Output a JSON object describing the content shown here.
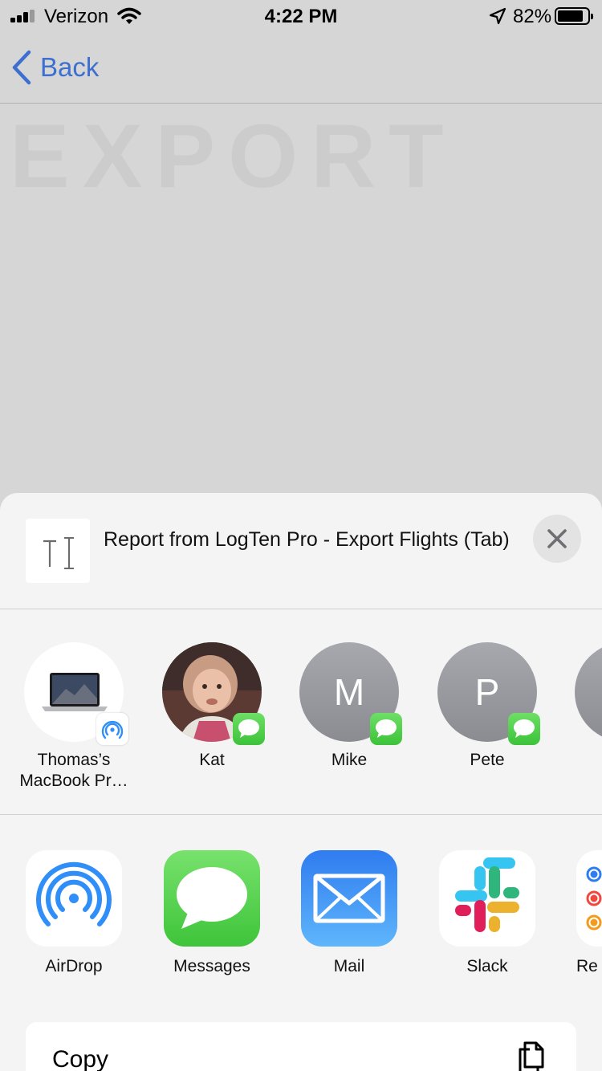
{
  "status_bar": {
    "carrier": "Verizon",
    "time": "4:22 PM",
    "battery": "82%"
  },
  "nav": {
    "back_label": "Back"
  },
  "background": {
    "title": "EXPORT"
  },
  "share_sheet": {
    "document_title": "Report from LogTen Pro - Export Flights (Tab)",
    "people": [
      {
        "name": "Thomas’s MacBook Pr…",
        "type": "airdrop-device"
      },
      {
        "name": "Kat",
        "type": "messages-contact"
      },
      {
        "name": "Mike",
        "initial": "M",
        "type": "messages-contact"
      },
      {
        "name": "Pete",
        "initial": "P",
        "type": "messages-contact"
      }
    ],
    "apps": [
      {
        "label": "AirDrop"
      },
      {
        "label": "Messages"
      },
      {
        "label": "Mail"
      },
      {
        "label": "Slack"
      },
      {
        "label": "Re"
      }
    ],
    "actions": [
      {
        "label": "Copy"
      }
    ]
  },
  "colors": {
    "link_blue": "#3c6fd0",
    "messages_green": "#4cd964",
    "airdrop_blue": "#2f8ef8",
    "mail_blue": "#3b8af2"
  }
}
